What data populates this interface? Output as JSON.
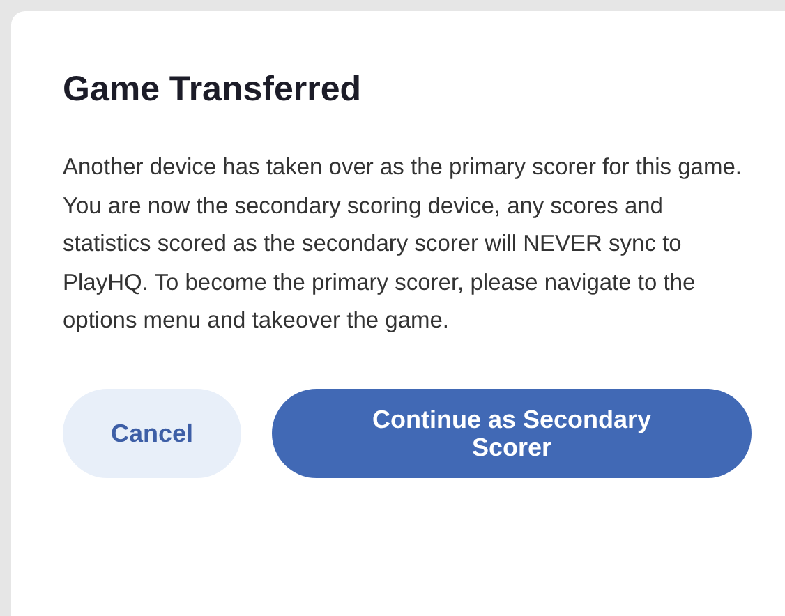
{
  "dialog": {
    "title": "Game Transferred",
    "message": "Another device has taken over as the primary scorer for this game. You are now the secondary scoring device, any scores and statistics scored as the secondary scorer will NEVER sync to PlayHQ. To become the primary scorer, please navigate to the options menu and takeover the game.",
    "buttons": [
      {
        "label": "Cancel",
        "kind": "secondary"
      },
      {
        "label": "Continue as Secondary Scorer",
        "kind": "primary"
      }
    ]
  }
}
